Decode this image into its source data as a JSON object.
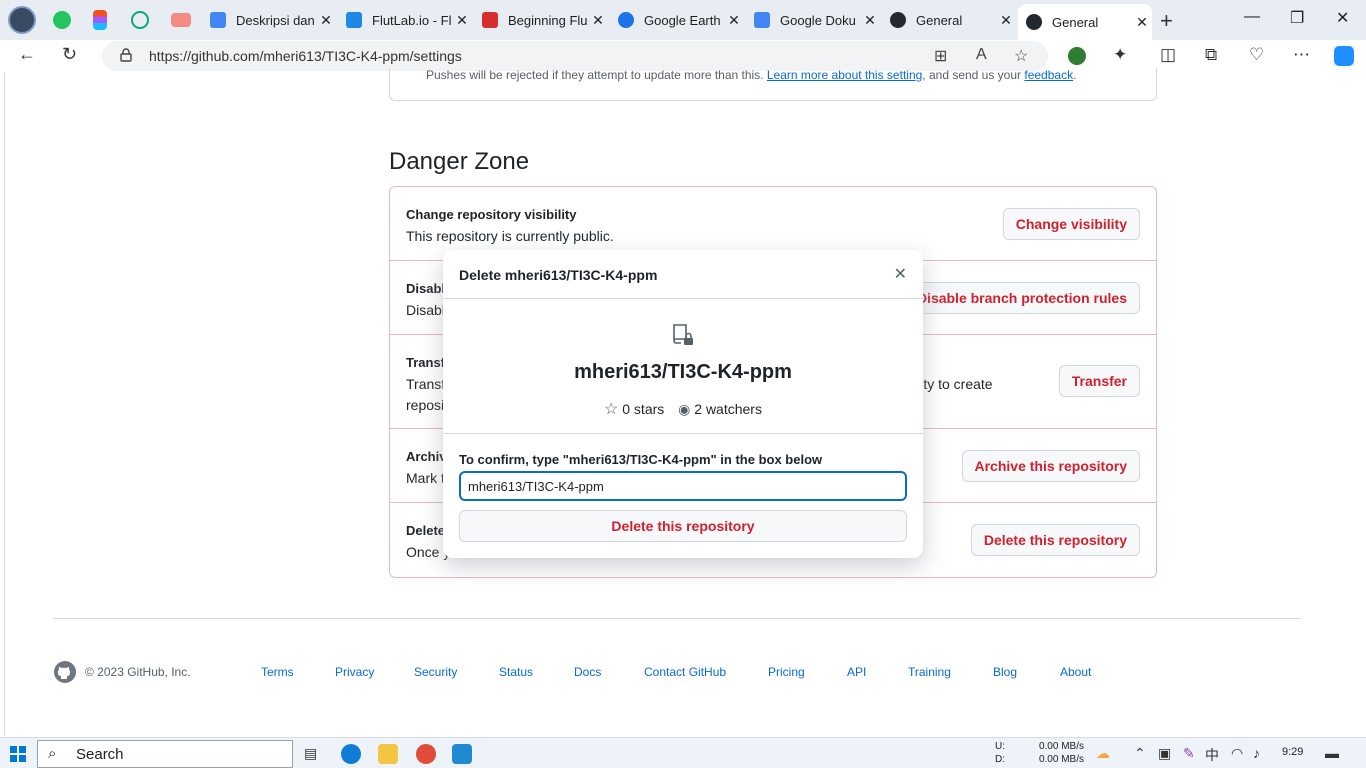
{
  "browser": {
    "tabs": [
      {
        "title": "Deskripsi dan",
        "color": "#4285f4"
      },
      {
        "title": "FlutLab.io - Fl",
        "color": "#1e88e5"
      },
      {
        "title": "Beginning Flu",
        "color": "#d32f2f"
      },
      {
        "title": "Google Earth",
        "color": "#1a73e8"
      },
      {
        "title": "Google Doku",
        "color": "#4285f4"
      },
      {
        "title": "General",
        "color": "#24292f"
      },
      {
        "title": "General",
        "color": "#24292f"
      }
    ],
    "url": "https://github.com/mheri613/TI3C-K4-ppm/settings"
  },
  "top_note": {
    "text": "Pushes will be rejected if they attempt to update more than this. ",
    "link1": "Learn more about this setting",
    "mid": ", and send us your ",
    "link2": "feedback",
    "end": "."
  },
  "danger_zone": {
    "title": "Danger Zone",
    "rows": [
      {
        "heading": "Change repository visibility",
        "desc": "This repository is currently public.",
        "button": "Change visibility"
      },
      {
        "heading": "Disabl",
        "desc": "Disabl",
        "button": "Disable branch protection rules"
      },
      {
        "heading": "Transf",
        "desc": "Transf",
        "desc_right": "ility to create",
        "desc2": "reposi",
        "button": "Transfer"
      },
      {
        "heading": "Archiv",
        "desc": "Mark t",
        "button": "Archive this repository"
      },
      {
        "heading": "Delete",
        "desc": "Once y",
        "button": "Delete this repository"
      }
    ]
  },
  "modal": {
    "title": "Delete mheri613/TI3C-K4-ppm",
    "repo": "mheri613/TI3C-K4-ppm",
    "stars": "0 stars",
    "watchers": "2 watchers",
    "confirm_label": "To confirm, type \"mheri613/TI3C-K4-ppm\" in the box below",
    "input_value": "mheri613/TI3C-K4-ppm",
    "button": "Delete this repository"
  },
  "footer": {
    "copyright": "© 2023 GitHub, Inc.",
    "links": [
      "Terms",
      "Privacy",
      "Security",
      "Status",
      "Docs",
      "Contact GitHub",
      "Pricing",
      "API",
      "Training",
      "Blog",
      "About"
    ]
  },
  "taskbar": {
    "search": "Search",
    "net_up_label": "U:",
    "net_down_label": "D:",
    "net_up": "0.00 MB/s",
    "net_down": "0.00 MB/s",
    "time": "9:29"
  }
}
